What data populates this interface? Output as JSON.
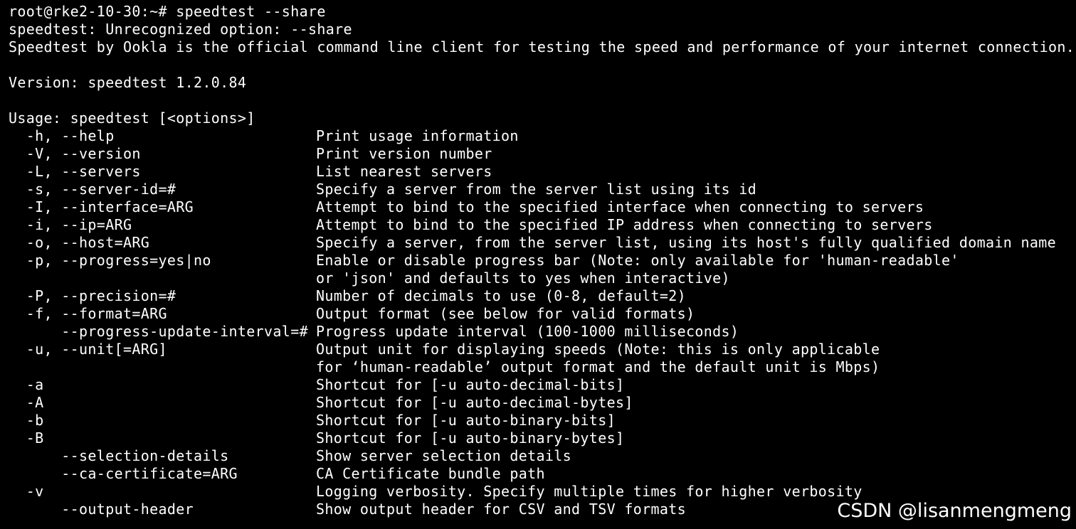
{
  "terminal": {
    "prompt_line": "root@rke2-10-30:~# speedtest --share",
    "error_line": "speedtest: Unrecognized option: --share",
    "intro_line": "Speedtest by Ookla is the official command line client for testing the speed and performance of your internet connection.",
    "version_line": "Version: speedtest 1.2.0.84",
    "usage_line": "Usage: speedtest [<options>]",
    "options": [
      {
        "opt": "  -h, --help",
        "desc": "Print usage information"
      },
      {
        "opt": "  -V, --version",
        "desc": "Print version number"
      },
      {
        "opt": "  -L, --servers",
        "desc": "List nearest servers"
      },
      {
        "opt": "  -s, --server-id=#",
        "desc": "Specify a server from the server list using its id"
      },
      {
        "opt": "  -I, --interface=ARG",
        "desc": "Attempt to bind to the specified interface when connecting to servers"
      },
      {
        "opt": "  -i, --ip=ARG",
        "desc": "Attempt to bind to the specified IP address when connecting to servers"
      },
      {
        "opt": "  -o, --host=ARG",
        "desc": "Specify a server, from the server list, using its host's fully qualified domain name"
      },
      {
        "opt": "  -p, --progress=yes|no",
        "desc": "Enable or disable progress bar (Note: only available for 'human-readable'"
      },
      {
        "opt": "",
        "desc": "or 'json' and defaults to yes when interactive)"
      },
      {
        "opt": "  -P, --precision=#",
        "desc": "Number of decimals to use (0-8, default=2)"
      },
      {
        "opt": "  -f, --format=ARG",
        "desc": "Output format (see below for valid formats)"
      },
      {
        "opt": "      --progress-update-interval=#",
        "desc": "Progress update interval (100-1000 milliseconds)"
      },
      {
        "opt": "  -u, --unit[=ARG]",
        "desc": "Output unit for displaying speeds (Note: this is only applicable"
      },
      {
        "opt": "",
        "desc": "for ‘human-readable’ output format and the default unit is Mbps)"
      },
      {
        "opt": "  -a",
        "desc": "Shortcut for [-u auto-decimal-bits]"
      },
      {
        "opt": "  -A",
        "desc": "Shortcut for [-u auto-decimal-bytes]"
      },
      {
        "opt": "  -b",
        "desc": "Shortcut for [-u auto-binary-bits]"
      },
      {
        "opt": "  -B",
        "desc": "Shortcut for [-u auto-binary-bytes]"
      },
      {
        "opt": "      --selection-details",
        "desc": "Show server selection details"
      },
      {
        "opt": "      --ca-certificate=ARG",
        "desc": "CA Certificate bundle path"
      },
      {
        "opt": "  -v",
        "desc": "Logging verbosity. Specify multiple times for higher verbosity"
      },
      {
        "opt": "      --output-header",
        "desc": "Show output header for CSV and TSV formats"
      }
    ]
  },
  "watermark": "CSDN @lisanmengmeng",
  "colors": {
    "background": "#000000",
    "text": "#ffffff"
  }
}
